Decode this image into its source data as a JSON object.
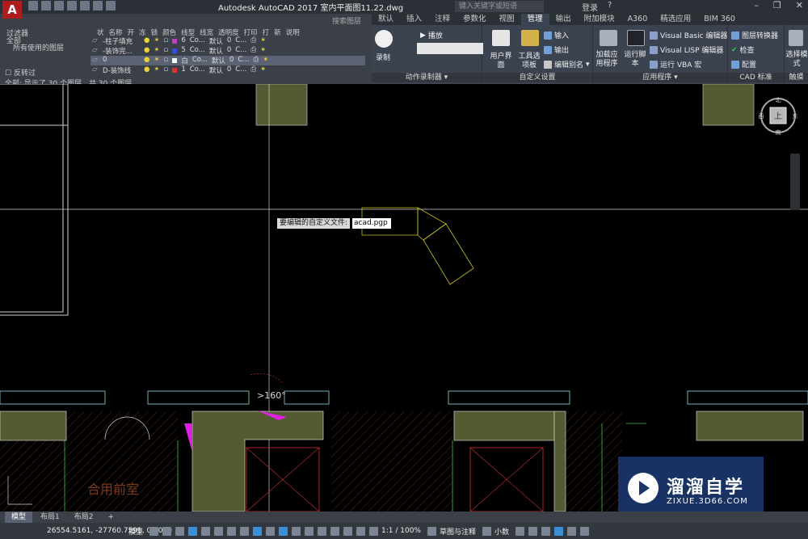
{
  "titlebar": {
    "app_icon": "A",
    "title": "Autodesk AutoCAD 2017    室内平面图11.22.dwg",
    "search_placeholder": "键入关键字或短语",
    "login": "登录"
  },
  "ribbon": {
    "tabs": [
      "默认",
      "插入",
      "注释",
      "参数化",
      "视图",
      "管理",
      "输出",
      "附加模块",
      "A360",
      "精选应用",
      "BIM 360"
    ],
    "active_tab": "管理",
    "groups": {
      "action_recorder": {
        "label": "动作录制器",
        "record": "录制",
        "play": "播放"
      },
      "customization": {
        "label": "自定义设置",
        "user_interface": "用户界面",
        "tool_palettes": "工具选项板",
        "import": "输入",
        "export": "输出",
        "edit_aliases": "编辑别名"
      },
      "applications": {
        "label": "应用程序",
        "load_app": "加载应用程序",
        "run_script": "运行脚本",
        "vba_editor": "Visual Basic 编辑器",
        "lisp_editor": "Visual LISP 编辑器",
        "run_vba": "运行 VBA 宏"
      },
      "cad_standards": {
        "label": "CAD 标准",
        "layer_translator": "图层转换器",
        "check": "检查",
        "configure": "配置"
      },
      "selection": {
        "label": "选择",
        "button": "选择模式",
        "footer": "触摸"
      }
    }
  },
  "layer_panel": {
    "search": "搜索图层",
    "filter_label": "过滤器",
    "all_label": "全部",
    "used_layers": "所有使用的图层",
    "invert": "反转过",
    "summary": "全部: 显示了 30 个图层，共 30 个图层",
    "headers": [
      "状",
      "名称",
      "开",
      "冻",
      "锁",
      "颜色",
      "线型",
      "线宽",
      "透明度",
      "打印",
      "打",
      "新",
      "说明"
    ],
    "rows": [
      {
        "name": "-柱子填充",
        "color_num": "6",
        "linetype": "Co...",
        "lineweight": "默认",
        "transp": "0",
        "plot": "C...",
        "swatch": "#c040c0"
      },
      {
        "name": "-装饰完...",
        "color_num": "5",
        "linetype": "Co...",
        "lineweight": "默认",
        "transp": "0",
        "plot": "C...",
        "swatch": "#3050e0"
      },
      {
        "name": "0",
        "color_num": "白",
        "linetype": "Co...",
        "lineweight": "默认",
        "transp": "0",
        "plot": "C...",
        "swatch": "#ffffff"
      },
      {
        "name": "D-装饰线",
        "color_num": "1",
        "linetype": "Co...",
        "lineweight": "默认",
        "transp": "0",
        "plot": "C...",
        "swatch": "#e03030"
      }
    ]
  },
  "drawing": {
    "prompt_label": "要编辑的自定义文件:",
    "prompt_value": "acad.pgp",
    "angle_label": ">160°",
    "room_label": "合用前室",
    "viewcube_face": "上",
    "viewcube_n": "北",
    "viewcube_s": "南",
    "viewcube_e": "东",
    "viewcube_w": "西"
  },
  "watermark": {
    "title": "溜溜自学",
    "url": "ZIXUE.3D66.COM"
  },
  "layout_tabs": [
    "模型",
    "布局1",
    "布局2",
    "+"
  ],
  "statusbar": {
    "coords": "26554.5161, -27760.7591, 0.0000",
    "model": "模型",
    "scale": "1:1 / 100%",
    "workspace": "草图与注释",
    "units": "小数"
  }
}
